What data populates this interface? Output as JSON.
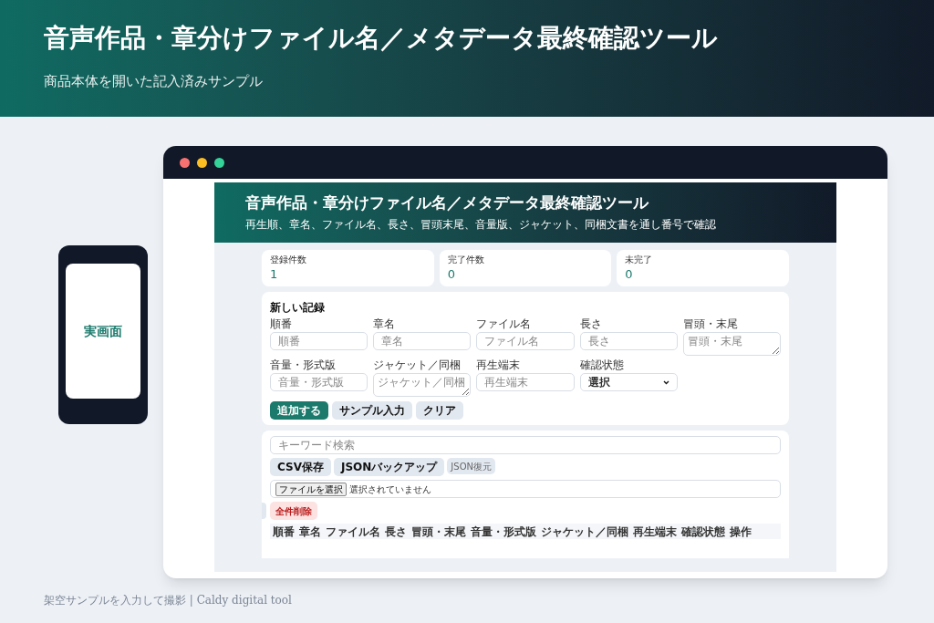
{
  "hero": {
    "title": "音声作品・章分けファイル名／メタデータ最終確認ツール",
    "subtitle": "商品本体を開いた記入済みサンプル"
  },
  "phone": {
    "label": "実画面"
  },
  "browser": {
    "dots": [
      {
        "color": "#f87171"
      },
      {
        "color": "#fbbf24"
      },
      {
        "color": "#34d399"
      }
    ]
  },
  "app": {
    "title": "音声作品・章分けファイル名／メタデータ最終確認ツール",
    "subtitle": "再生順、章名、ファイル名、長さ、冒頭末尾、音量版、ジャケット、同梱文書を通し番号で確認",
    "stats": [
      {
        "label": "登録件数",
        "value": "1"
      },
      {
        "label": "完了件数",
        "value": "0"
      },
      {
        "label": "未完了",
        "value": "0"
      }
    ],
    "form": {
      "title": "新しい記録",
      "fields": [
        {
          "label": "順番",
          "placeholder": "順番",
          "kind": "input"
        },
        {
          "label": "章名",
          "placeholder": "章名",
          "kind": "input"
        },
        {
          "label": "ファイル名",
          "placeholder": "ファイル名",
          "kind": "input"
        },
        {
          "label": "長さ",
          "placeholder": "長さ",
          "kind": "input"
        },
        {
          "label": "冒頭・末尾",
          "placeholder": "冒頭・末尾",
          "kind": "textarea"
        },
        {
          "label": "音量・形式版",
          "placeholder": "音量・形式版",
          "kind": "input"
        },
        {
          "label": "ジャケット／同梱",
          "placeholder": "ジャケット／同梱",
          "kind": "textarea"
        },
        {
          "label": "再生端末",
          "placeholder": "再生端末",
          "kind": "input"
        },
        {
          "label": "確認状態",
          "value": "選択",
          "kind": "select"
        }
      ],
      "buttons": [
        {
          "label": "追加する",
          "kind": "primary"
        },
        {
          "label": "サンプル入力",
          "kind": "secondary"
        },
        {
          "label": "クリア",
          "kind": "secondary"
        }
      ]
    },
    "list": {
      "search_placeholder": "キーワード検索",
      "buttons": [
        {
          "label": "CSV保存",
          "kind": "secondary"
        },
        {
          "label": "JSONバックアップ",
          "kind": "secondary"
        },
        {
          "label": "JSON復元",
          "kind": "small"
        }
      ],
      "file_button": "ファイルを選択",
      "file_status": "選択されていません",
      "delete_all": "全件削除",
      "columns": [
        "順番",
        "章名",
        "ファイル名",
        "長さ",
        "冒頭・末尾",
        "音量・形式版",
        "ジャケット／同梱",
        "再生端末",
        "確認状態",
        "操作"
      ]
    }
  },
  "footer": {
    "credit": "架空サンプルを入力して撮影 | Caldy digital tool"
  }
}
